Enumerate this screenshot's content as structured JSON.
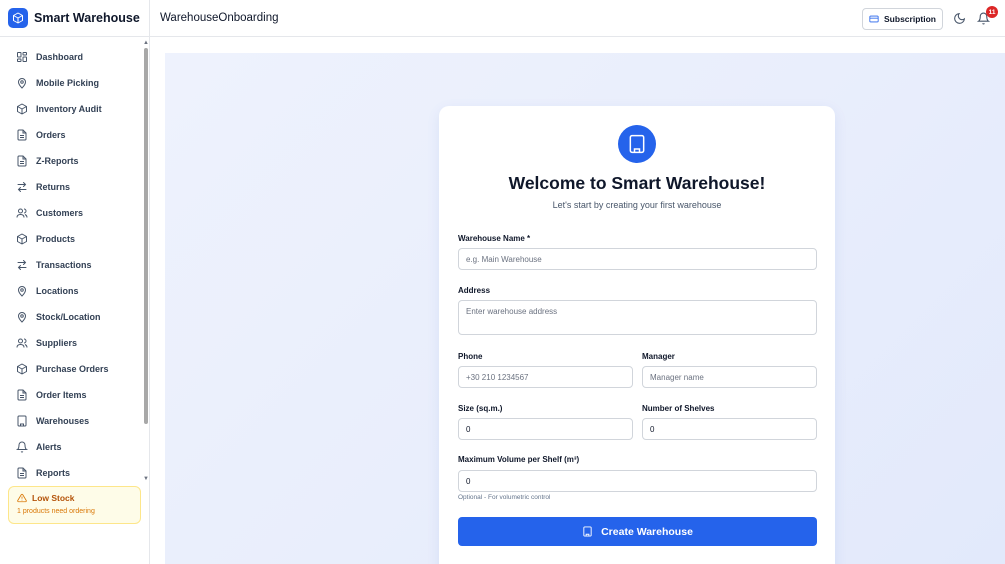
{
  "brand": {
    "name": "Smart Warehouse",
    "logo_icon": "box-icon"
  },
  "sidebar": {
    "items": [
      {
        "label": "Dashboard",
        "icon": "grid-icon"
      },
      {
        "label": "Mobile Picking",
        "icon": "map-pin-icon"
      },
      {
        "label": "Inventory Audit",
        "icon": "box-icon"
      },
      {
        "label": "Orders",
        "icon": "file-text-icon"
      },
      {
        "label": "Z-Reports",
        "icon": "file-text-icon"
      },
      {
        "label": "Returns",
        "icon": "arrows-swap-icon"
      },
      {
        "label": "Customers",
        "icon": "users-icon"
      },
      {
        "label": "Products",
        "icon": "box-icon"
      },
      {
        "label": "Transactions",
        "icon": "arrows-swap-icon"
      },
      {
        "label": "Locations",
        "icon": "map-pin-icon"
      },
      {
        "label": "Stock/Location",
        "icon": "map-pin-icon"
      },
      {
        "label": "Suppliers",
        "icon": "users-icon"
      },
      {
        "label": "Purchase Orders",
        "icon": "box-icon"
      },
      {
        "label": "Order Items",
        "icon": "file-text-icon"
      },
      {
        "label": "Warehouses",
        "icon": "building-icon"
      },
      {
        "label": "Alerts",
        "icon": "bell-icon"
      },
      {
        "label": "Reports",
        "icon": "file-text-icon"
      }
    ],
    "low_stock": {
      "title": "Low Stock",
      "message": "1 products need ordering"
    }
  },
  "header": {
    "title": "WarehouseOnboarding",
    "subscription_label": "Subscription",
    "notification_count": "11"
  },
  "onboarding": {
    "title": "Welcome to Smart Warehouse!",
    "subtitle": "Let's start by creating your first warehouse",
    "fields": {
      "name": {
        "label": "Warehouse Name *",
        "placeholder": "e.g. Main Warehouse"
      },
      "address": {
        "label": "Address",
        "placeholder": "Enter warehouse address"
      },
      "phone": {
        "label": "Phone",
        "placeholder": "+30 210 1234567"
      },
      "manager": {
        "label": "Manager",
        "placeholder": "Manager name"
      },
      "size": {
        "label": "Size (sq.m.)",
        "value": "0"
      },
      "shelves": {
        "label": "Number of Shelves",
        "value": "0"
      },
      "volume": {
        "label": "Maximum Volume per Shelf (m³)",
        "value": "0",
        "hint": "Optional - For volumetric control"
      }
    },
    "submit_label": "Create Warehouse"
  },
  "colors": {
    "accent": "#2563eb",
    "warning_bg": "#fefce8",
    "warning_text": "#b45309",
    "badge": "#dc2626"
  }
}
